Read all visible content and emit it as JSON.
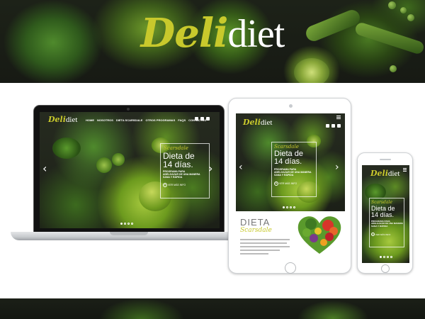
{
  "brand": {
    "part1": "Deli",
    "part2": "diet"
  },
  "site": {
    "nav": [
      "HOME",
      "NOSOTROS",
      "DIETA SCARSDALE",
      "OTROS PROGRAMAS",
      "FAQS",
      "CONTACTOS"
    ],
    "hero": {
      "script": "Scarsdale",
      "heading1": "Dieta de",
      "heading2": "14 días.",
      "desc": [
        "PROGRAMA PARA",
        "ADELGAZAR DE UNA MANERA",
        "SANA Y RÁPIDA"
      ],
      "more": "VER MÁS INFO",
      "prev": "‹",
      "next": "›"
    },
    "section": {
      "title": "DIETA",
      "script": "Scarsdale"
    }
  },
  "colors": {
    "accent": "#c8c92c",
    "dark_bg": "#1c2017",
    "white": "#ffffff"
  }
}
